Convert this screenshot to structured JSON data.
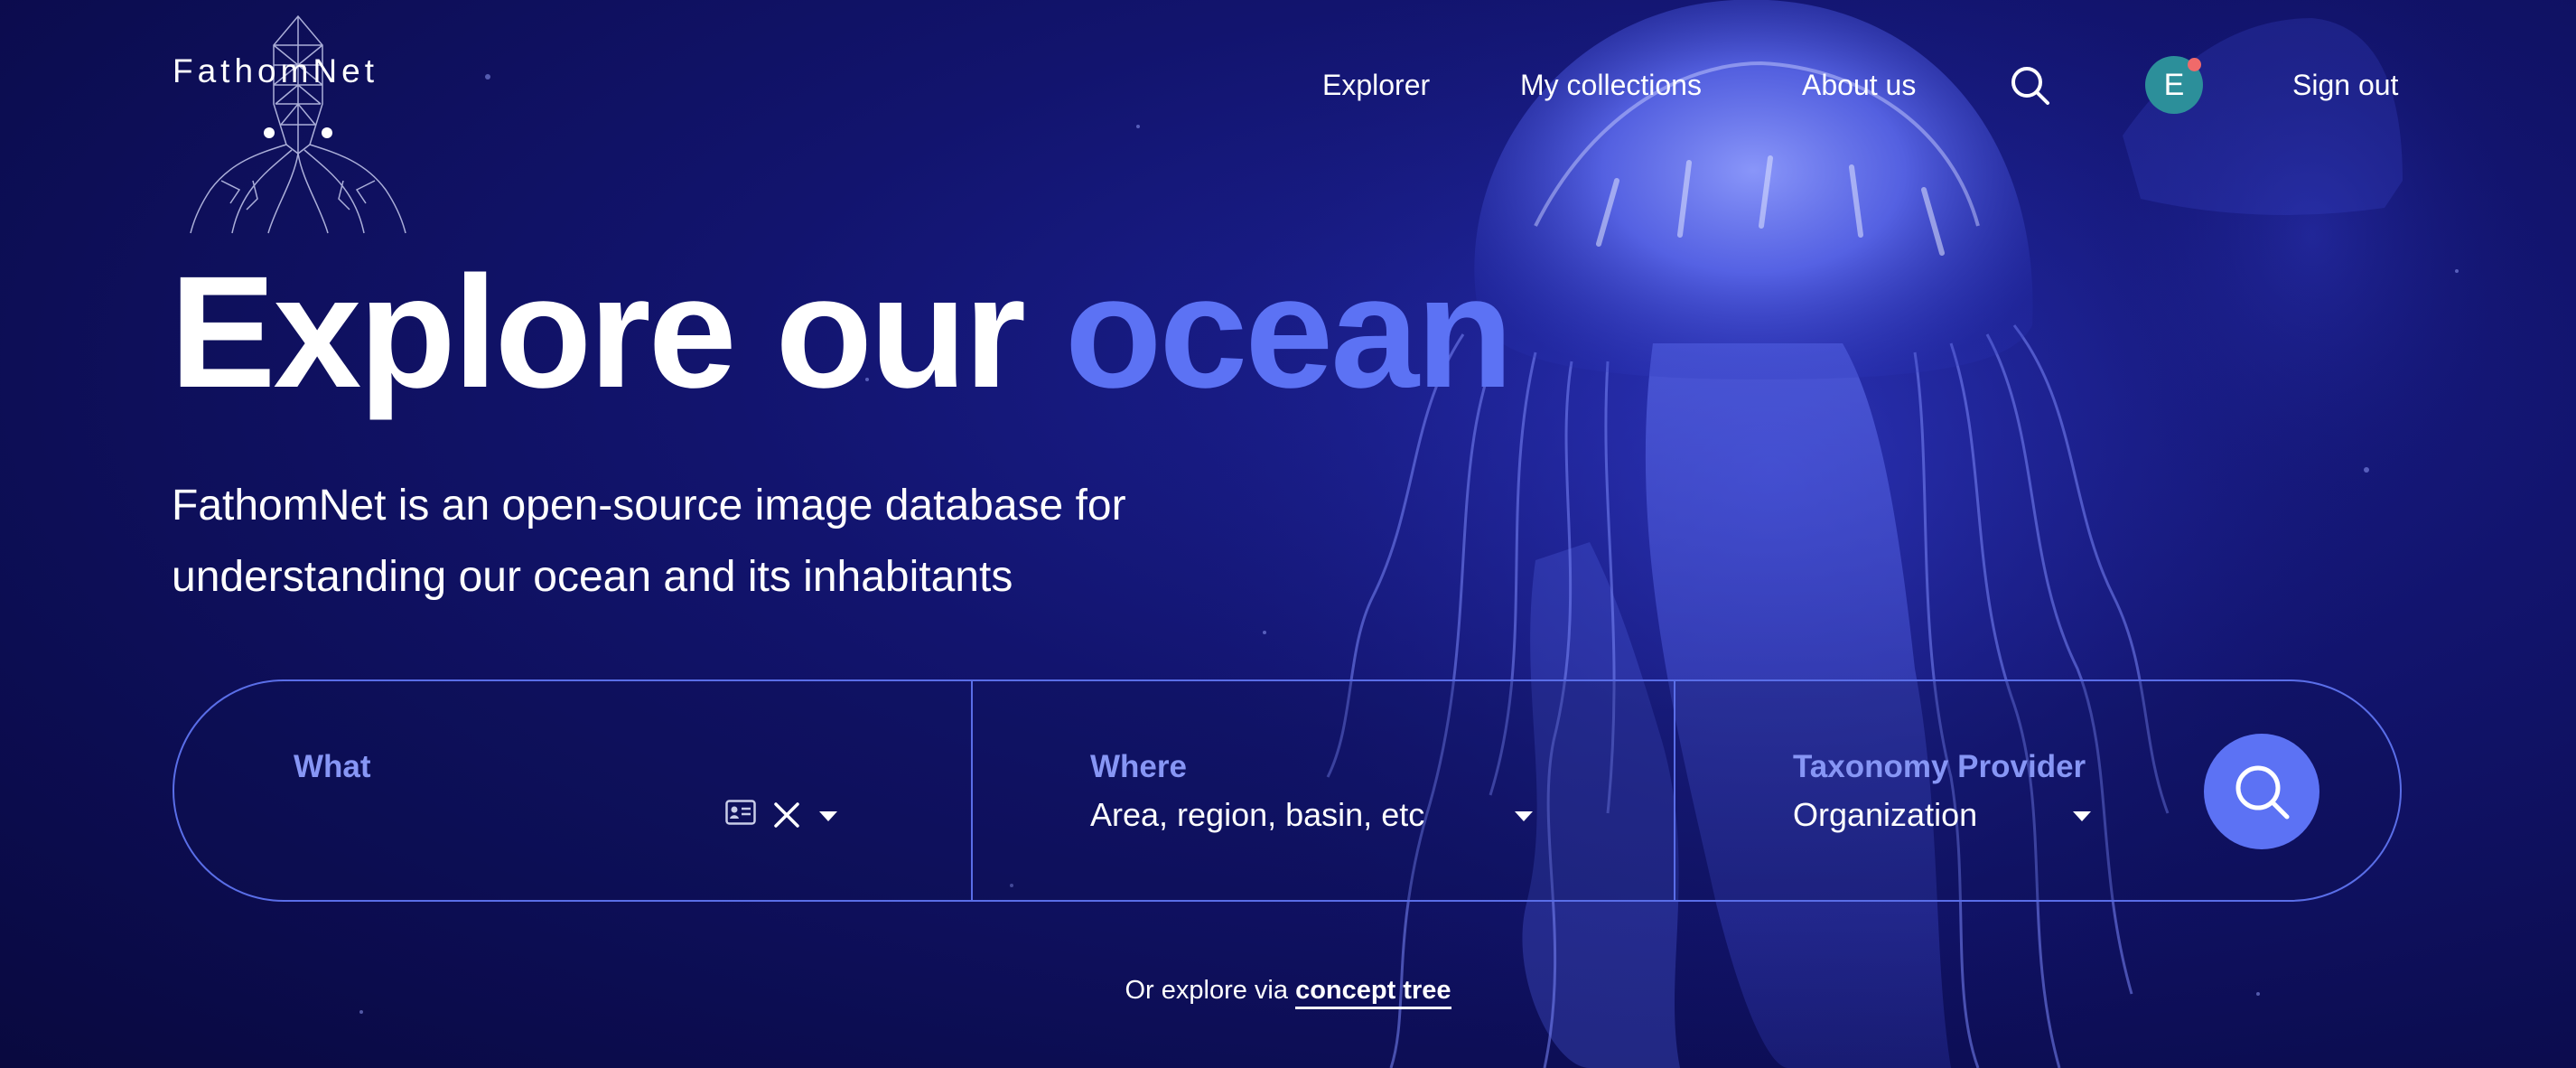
{
  "brand": {
    "name": "FathomNet"
  },
  "nav": {
    "explorer": "Explorer",
    "collections": "My collections",
    "about": "About us",
    "avatar_initial": "E",
    "sign_out": "Sign out"
  },
  "hero": {
    "title_main": "Explore our",
    "title_accent": "ocean",
    "subtitle_line1": "FathomNet is an open-source image database for",
    "subtitle_line2": "understanding our ocean and its inhabitants"
  },
  "search": {
    "what_label": "What",
    "what_value": "",
    "where_label": "Where",
    "where_value": "Area, region, basin, etc",
    "taxonomy_label": "Taxonomy Provider",
    "taxonomy_value": "Organization"
  },
  "footer": {
    "explore_prefix": "Or explore via",
    "concept_tree": "concept tree"
  },
  "colors": {
    "background": "#0c0d52",
    "accent": "#5c72f4",
    "label": "#8796f5",
    "avatar": "#2c8f9a",
    "notification": "#f06a6a"
  },
  "icons": {
    "logo": "squid-logo-icon",
    "nav_search": "search-icon",
    "id_card": "id-card-icon",
    "clear": "close-icon",
    "dropdown": "caret-down-icon",
    "submit": "search-icon"
  }
}
